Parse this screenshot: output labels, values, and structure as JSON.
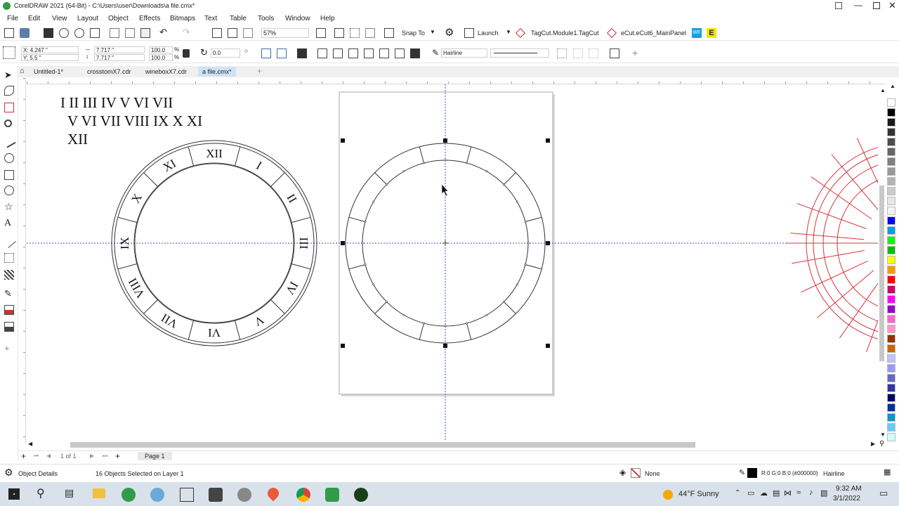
{
  "window": {
    "title": "CorelDRAW 2021 (64-Bit) - C:\\Users\\user\\Downloads\\a file.cmx*"
  },
  "menu": [
    "File",
    "Edit",
    "View",
    "Layout",
    "Object",
    "Effects",
    "Bitmaps",
    "Text",
    "Table",
    "Tools",
    "Window",
    "Help"
  ],
  "toolbar": {
    "zoom": "57%",
    "snap_to": "Snap To",
    "launch": "Launch",
    "plugin1": "TagCut.Module1.TagCut",
    "plugin2": "eCut.eCut6_MainPanel"
  },
  "props": {
    "x": "X: 4.247 \"",
    "y": "Y: 5.5 \"",
    "w": "7.717 \"",
    "h": "7.717 \"",
    "sx": "100.0",
    "sy": "100.0",
    "pct": "%",
    "rotation": "0.0",
    "outline": "Hairline"
  },
  "tabs": [
    "Untitled-1*",
    "crosstomX7.cdr",
    "wineboxX7.cdr",
    "a file.cmx*"
  ],
  "canvas": {
    "roman_lines": [
      "I   II III IV V VI VII",
      "V VI VII VIII IX X XI",
      "XII"
    ],
    "dial_numerals": [
      "XII",
      "I",
      "II",
      "III",
      "IV",
      "V",
      "VI",
      "VII",
      "VIII",
      "IX",
      "X",
      "XI"
    ]
  },
  "pagebar": {
    "page_count": "1  of  1",
    "page_tab": "Page 1"
  },
  "status": {
    "details": "Object Details",
    "selection": "16 Objects Selected on Layer 1",
    "fill": "None",
    "outline_color": "R:0 G:0 B:0 (#000000)",
    "outline_width": "Hairline"
  },
  "taskbar": {
    "weather": "44°F  Sunny",
    "time": "9:32 AM",
    "date": "3/1/2022"
  },
  "palette_colors": [
    "#ffffff",
    "#000000",
    "#1a1a1a",
    "#333333",
    "#4d4d4d",
    "#666666",
    "#808080",
    "#999999",
    "#b3b3b3",
    "#cccccc",
    "#e6e6e6",
    "#f2f2f2",
    "#0000ff",
    "#00a0e9",
    "#00ff00",
    "#00c000",
    "#ffff00",
    "#ff9900",
    "#ff0000",
    "#cc0066",
    "#ff00ff",
    "#9900cc",
    "#ff66cc",
    "#ff99cc",
    "#993300",
    "#cc6600",
    "#c0c0ff",
    "#9999ff",
    "#6666cc",
    "#3333aa",
    "#000066",
    "#003399",
    "#0099cc",
    "#66ccff",
    "#ccffff"
  ],
  "colors": {
    "accent": "#cfe3f7",
    "guide": "#3b4bd6",
    "red_lines": "#d9333a"
  }
}
